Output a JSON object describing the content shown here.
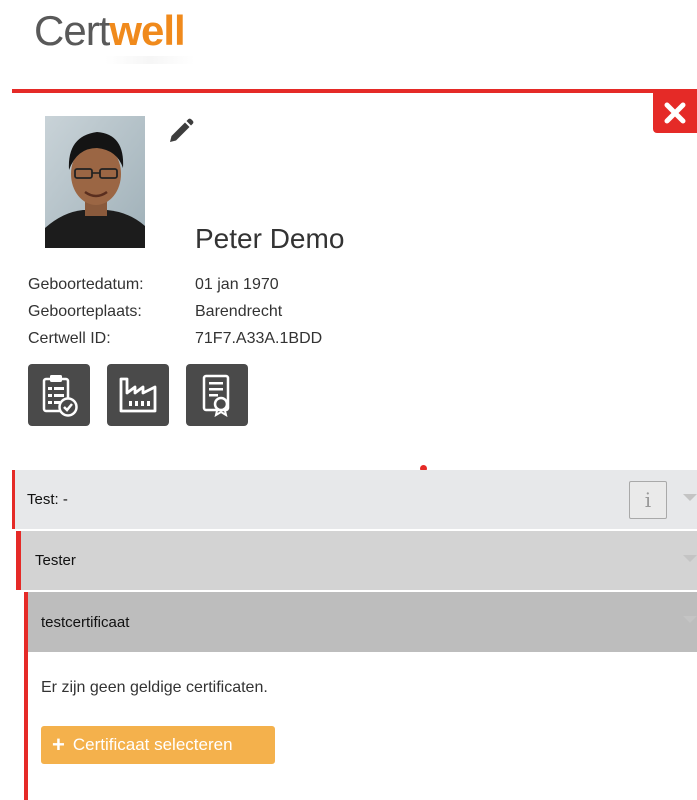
{
  "brand": {
    "logo_part1": "Cert",
    "logo_part2": "well"
  },
  "colors": {
    "accent_red": "#e52a27",
    "brand_orange": "#f08a1c",
    "button_orange": "#f4b14c",
    "tile_gray": "#4a4a4a"
  },
  "icons": {
    "close": "close-icon",
    "edit": "pencil-icon",
    "tiles": [
      "clipboard-check-icon",
      "factory-icon",
      "certificate-icon"
    ],
    "add": "plus-icon",
    "chevron": "chevron-down-icon"
  },
  "profile": {
    "name": "Peter Demo",
    "fields": [
      {
        "label": "Geboortedatum:",
        "value": "01 jan 1970"
      },
      {
        "label": "Geboorteplaats:",
        "value": "Barendrecht"
      },
      {
        "label": "Certwell ID:",
        "value": "71F7.A33A.1BDD"
      }
    ]
  },
  "accordion": {
    "level1": {
      "label": "Test: -",
      "info_label": "i"
    },
    "level2": {
      "label": "Tester"
    },
    "level3": {
      "label": "testcertificaat"
    }
  },
  "content": {
    "empty_message": "Er zijn geen geldige certificaten.",
    "select_button": "Certificaat selecteren",
    "select_button_icon": "+"
  }
}
